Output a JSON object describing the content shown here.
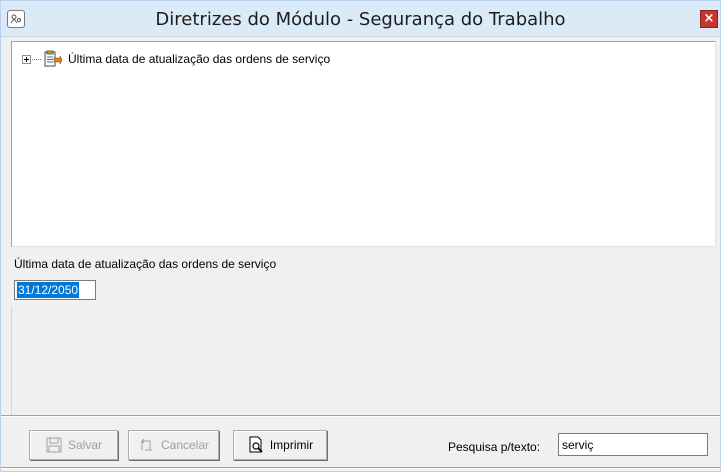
{
  "window": {
    "title": "Diretrizes do Módulo - Segurança do Trabalho",
    "close_glyph": "×"
  },
  "tree": {
    "items": [
      {
        "label": "Última data de atualização das ordens de serviço",
        "icon": "document-edit-icon"
      }
    ]
  },
  "detail": {
    "label": "Última data de atualização das ordens de serviço",
    "value": "31/12/2050"
  },
  "toolbar": {
    "save_label": "Salvar",
    "cancel_label": "Cancelar",
    "print_label": "Imprimir",
    "search_label": "Pesquisa p/texto:",
    "search_value": "serviç"
  },
  "colors": {
    "titlebar": "#dbeaf7",
    "close_button": "#c7352c",
    "selection": "#0078d7"
  }
}
